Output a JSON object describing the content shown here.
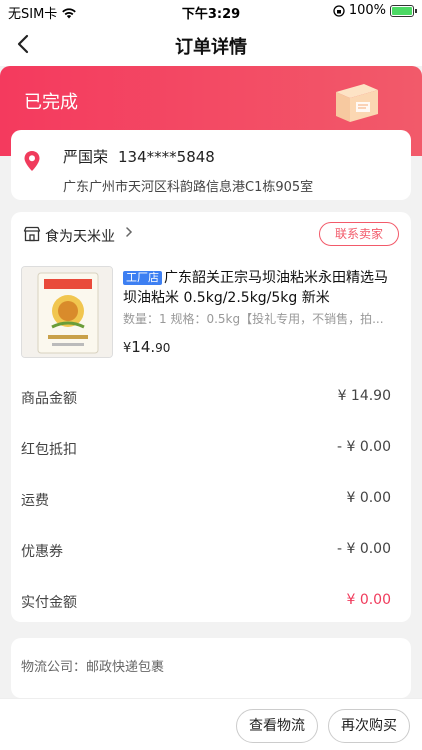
{
  "status_bar": {
    "carrier": "无SIM卡",
    "time": "下午3:29",
    "battery": "100%"
  },
  "nav": {
    "title": "订单详情"
  },
  "hero": {
    "status": "已完成"
  },
  "address": {
    "name": "严国荣",
    "phone": "134****5848",
    "detail": "广东广州市天河区科韵路信息港C1栋905室"
  },
  "shop": {
    "name": "食为天米业",
    "contact_label": "联系卖家"
  },
  "product": {
    "tag": "工厂店",
    "title": "广东韶关正宗马坝油粘米永田精选马坝油粘米 0.5kg/2.5kg/5kg 新米",
    "spec": "数量：1    规格：0.5kg【投礼专用，不销售，拍...",
    "price_symbol": "¥",
    "price_int": "14.",
    "price_dec": "90"
  },
  "summary": [
    {
      "label": "商品金额",
      "value": "¥ 14.90"
    },
    {
      "label": "红包抵扣",
      "value": "- ¥ 0.00"
    },
    {
      "label": "运费",
      "value": "¥ 0.00"
    },
    {
      "label": "优惠券",
      "value": "- ¥ 0.00"
    },
    {
      "label": "实付金额",
      "value": "¥ 0.00"
    }
  ],
  "logistics": {
    "text": "物流公司：邮政快递包裹"
  },
  "actions": {
    "view_logistics": "查看物流",
    "rebuy": "再次购买"
  },
  "colors": {
    "accent": "#f03b5c",
    "tag_blue": "#3d7ff2"
  }
}
